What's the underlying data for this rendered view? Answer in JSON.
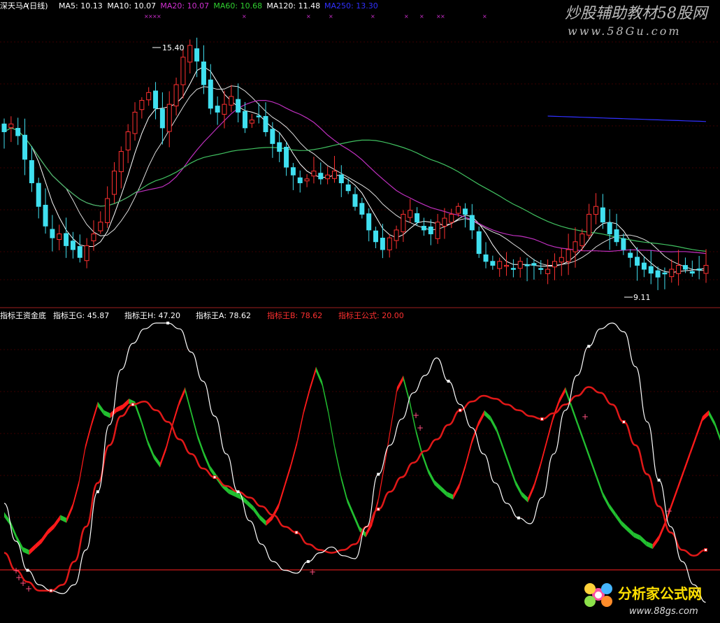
{
  "chart_data": [
    {
      "type": "candlestick",
      "security": "深天马A",
      "period": "(日线)",
      "ma_legend": [
        {
          "label": "MA5:",
          "value": "10.13",
          "color": "#ffffff"
        },
        {
          "label": "MA10:",
          "value": "10.07",
          "color": "#ffffff"
        },
        {
          "label": "MA20:",
          "value": "10.07",
          "color": "#d030d0"
        },
        {
          "label": "MA60:",
          "value": "10.68",
          "color": "#30d030"
        },
        {
          "label": "MA120:",
          "value": "11.48",
          "color": "#ffffff"
        },
        {
          "label": "MA250:",
          "value": "13.30",
          "color": "#3030ff"
        }
      ],
      "annotations": [
        {
          "text": "15.40",
          "price": 15.4
        },
        {
          "text": "9.11",
          "price": 9.11
        }
      ],
      "ylim": [
        8.6,
        15.9
      ],
      "grid": true,
      "closes": [
        12.9,
        13.1,
        12.8,
        12.2,
        11.6,
        11.0,
        10.5,
        10.2,
        10.3,
        10.0,
        9.9,
        9.7,
        10.0,
        10.3,
        10.6,
        11.2,
        11.9,
        12.4,
        12.9,
        13.4,
        13.7,
        13.9,
        13.5,
        13.0,
        13.6,
        14.1,
        14.8,
        15.1,
        14.7,
        14.1,
        13.5,
        13.4,
        13.6,
        13.8,
        13.4,
        13.0,
        13.2,
        13.3,
        12.9,
        12.6,
        12.4,
        12.0,
        11.8,
        11.6,
        11.7,
        11.9,
        11.7,
        11.8,
        11.9,
        11.6,
        11.4,
        11.0,
        10.8,
        10.4,
        10.1,
        9.9,
        10.2,
        10.4,
        10.8,
        10.9,
        10.6,
        10.4,
        10.3,
        10.6,
        10.7,
        10.8,
        11.0,
        10.8,
        10.4,
        9.8,
        9.6,
        9.5,
        9.6,
        9.5,
        9.4,
        9.6,
        9.5,
        9.5,
        9.4,
        9.4,
        9.6,
        9.7,
        9.9,
        10.1,
        10.3,
        10.8,
        11.0,
        10.6,
        10.3,
        10.1,
        9.9,
        9.7,
        9.5,
        9.4,
        9.3,
        9.2,
        9.3,
        9.4,
        9.5,
        9.4,
        9.3,
        9.4,
        9.5
      ]
    },
    {
      "type": "line",
      "indicator_name": "指标王资金底",
      "legend": [
        {
          "label": "指标王G:",
          "value": "45.87",
          "color": "#ffffff"
        },
        {
          "label": "指标王H:",
          "value": "47.20",
          "color": "#ffffff"
        },
        {
          "label": "指标王A:",
          "value": "78.62",
          "color": "#ffffff"
        },
        {
          "label": "指标王B:",
          "value": "78.62",
          "color": "#ff3030"
        },
        {
          "label": "指标王公式:",
          "value": "20.00",
          "color": "#ff3030"
        }
      ],
      "ylim": [
        0,
        100
      ],
      "reference_line": 20,
      "white_line": {
        "x": [
          0,
          15,
          30,
          45,
          60,
          75,
          90,
          105,
          120,
          135,
          150,
          165,
          180,
          195,
          210,
          225,
          240,
          255,
          270,
          285,
          300,
          315,
          330,
          345,
          360,
          375,
          390,
          405,
          420,
          435,
          450,
          465,
          480,
          495,
          510,
          525,
          540,
          555,
          570,
          585,
          600,
          615,
          630,
          645,
          660,
          675,
          690,
          705,
          720,
          735,
          750,
          765,
          780,
          795,
          810,
          825,
          840,
          855,
          870,
          885,
          900
        ],
        "y": [
          38,
          25,
          15,
          10,
          8,
          7,
          10,
          22,
          42,
          65,
          84,
          93,
          98,
          100,
          100,
          98,
          90,
          80,
          68,
          55,
          42,
          32,
          24,
          18,
          15,
          14,
          18,
          21,
          23,
          20,
          19,
          30,
          48,
          58,
          67,
          76,
          82,
          88,
          80,
          72,
          64,
          55,
          45,
          38,
          33,
          31,
          40,
          55,
          70,
          82,
          92,
          98,
          100,
          97,
          85,
          66,
          46,
          30,
          18,
          10,
          4
        ]
      },
      "red_line": {
        "x": [
          0,
          15,
          30,
          45,
          60,
          75,
          90,
          105,
          120,
          135,
          150,
          165,
          180,
          195,
          210,
          225,
          240,
          255,
          270,
          285,
          300,
          315,
          330,
          345,
          360,
          375,
          390,
          405,
          420,
          435,
          450,
          465,
          480,
          495,
          510,
          525,
          540,
          555,
          570,
          585,
          600,
          615,
          630,
          645,
          660,
          675,
          690,
          705,
          720,
          735,
          750,
          765,
          780,
          795,
          810,
          825,
          840,
          855,
          870,
          885,
          900
        ],
        "y": [
          21,
          15,
          11,
          8,
          8,
          10,
          18,
          30,
          45,
          58,
          68,
          72,
          73,
          70,
          66,
          60,
          55,
          50,
          47,
          44,
          42,
          40,
          37,
          34,
          30,
          28,
          24,
          22,
          21,
          22,
          24,
          30,
          36,
          42,
          47,
          52,
          56,
          60,
          65,
          70,
          73,
          75,
          74,
          72,
          70,
          68,
          67,
          69,
          72,
          75,
          78,
          76,
          72,
          66,
          58,
          48,
          37,
          28,
          22,
          20,
          22
        ]
      },
      "ribbon": {
        "x": [
          0,
          8,
          16,
          24,
          32,
          40,
          48,
          56,
          64,
          72,
          80,
          88,
          96,
          104,
          112,
          120,
          128,
          136,
          144,
          152,
          160,
          168,
          176,
          184,
          192,
          200,
          208,
          216,
          224,
          232,
          240,
          248,
          256,
          264,
          272,
          280,
          288,
          296,
          304,
          312,
          320,
          328,
          336,
          344,
          352,
          360,
          368,
          376,
          384,
          392,
          400,
          408,
          416,
          424,
          432,
          440,
          448,
          456,
          464,
          472,
          480,
          488,
          496,
          504,
          512,
          520,
          528,
          536,
          544,
          552,
          560,
          568,
          576,
          584,
          592,
          600,
          608,
          616,
          624,
          632,
          640,
          648,
          656,
          664,
          672,
          680,
          688,
          696,
          704,
          712,
          720,
          728,
          736,
          744,
          752,
          760,
          768,
          776,
          784,
          792,
          800,
          808,
          816,
          824,
          832,
          840,
          848,
          856,
          864,
          872,
          880,
          888,
          896,
          904,
          912,
          920,
          928,
          936,
          944,
          952,
          960,
          968,
          976,
          984,
          992,
          1000,
          1008
        ],
        "y": [
          35,
          32,
          27,
          23,
          22,
          24,
          26,
          29,
          31,
          34,
          33,
          38,
          46,
          58,
          66,
          73,
          70,
          69,
          71,
          72,
          74,
          73,
          67,
          60,
          55,
          52,
          58,
          66,
          73,
          78,
          70,
          62,
          56,
          51,
          48,
          45,
          43,
          42,
          41,
          39,
          37,
          34,
          32,
          34,
          38,
          45,
          52,
          60,
          70,
          78,
          85,
          80,
          70,
          58,
          48,
          40,
          35,
          30,
          28,
          32,
          40,
          52,
          65,
          78,
          82,
          74,
          64,
          56,
          50,
          46,
          44,
          42,
          41,
          45,
          52,
          60,
          66,
          70,
          68,
          64,
          58,
          52,
          46,
          42,
          40,
          45,
          52,
          60,
          68,
          74,
          78,
          72,
          66,
          60,
          54,
          48,
          42,
          38,
          35,
          32,
          30,
          28,
          27,
          25,
          24,
          27,
          32,
          38,
          44,
          50,
          56,
          62,
          68,
          70,
          66,
          60,
          55,
          50,
          46,
          44,
          48,
          52,
          56,
          60,
          64,
          66,
          68
        ]
      }
    }
  ],
  "watermark_top": {
    "cn": "炒股辅助教材58股网",
    "url": "www.58Gu.com"
  },
  "watermark_bottom": {
    "cn": "分析家公式网",
    "url": "www.88gs.com"
  }
}
